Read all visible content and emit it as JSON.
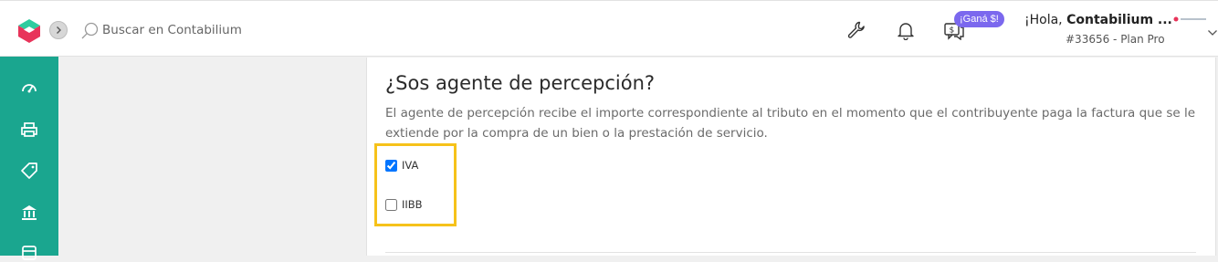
{
  "header": {
    "search_placeholder": "Buscar en Contabilium",
    "promo_badge": "¡Ganá $!",
    "greeting_prefix": "¡Hola, ",
    "greeting_name": "Contabilium ...",
    "plan_info": "#33656 - Plan Pro"
  },
  "sidebar": {
    "items": [
      "dashboard-icon",
      "printer-icon",
      "tag-icon",
      "bank-icon",
      "box-icon"
    ]
  },
  "section": {
    "title": "¿Sos agente de percepción?",
    "description": "El agente de percepción recibe el importe correspondiente al tributo en el momento que el contribuyente paga la factura que se le extiende por la compra de un bien o la prestación de servicio.",
    "options": [
      {
        "label": "IVA",
        "checked": true
      },
      {
        "label": "IIBB",
        "checked": false
      }
    ]
  },
  "colors": {
    "sidebar": "#1aa68f",
    "highlight": "#f6c21a",
    "badge": "#7b68ee"
  }
}
